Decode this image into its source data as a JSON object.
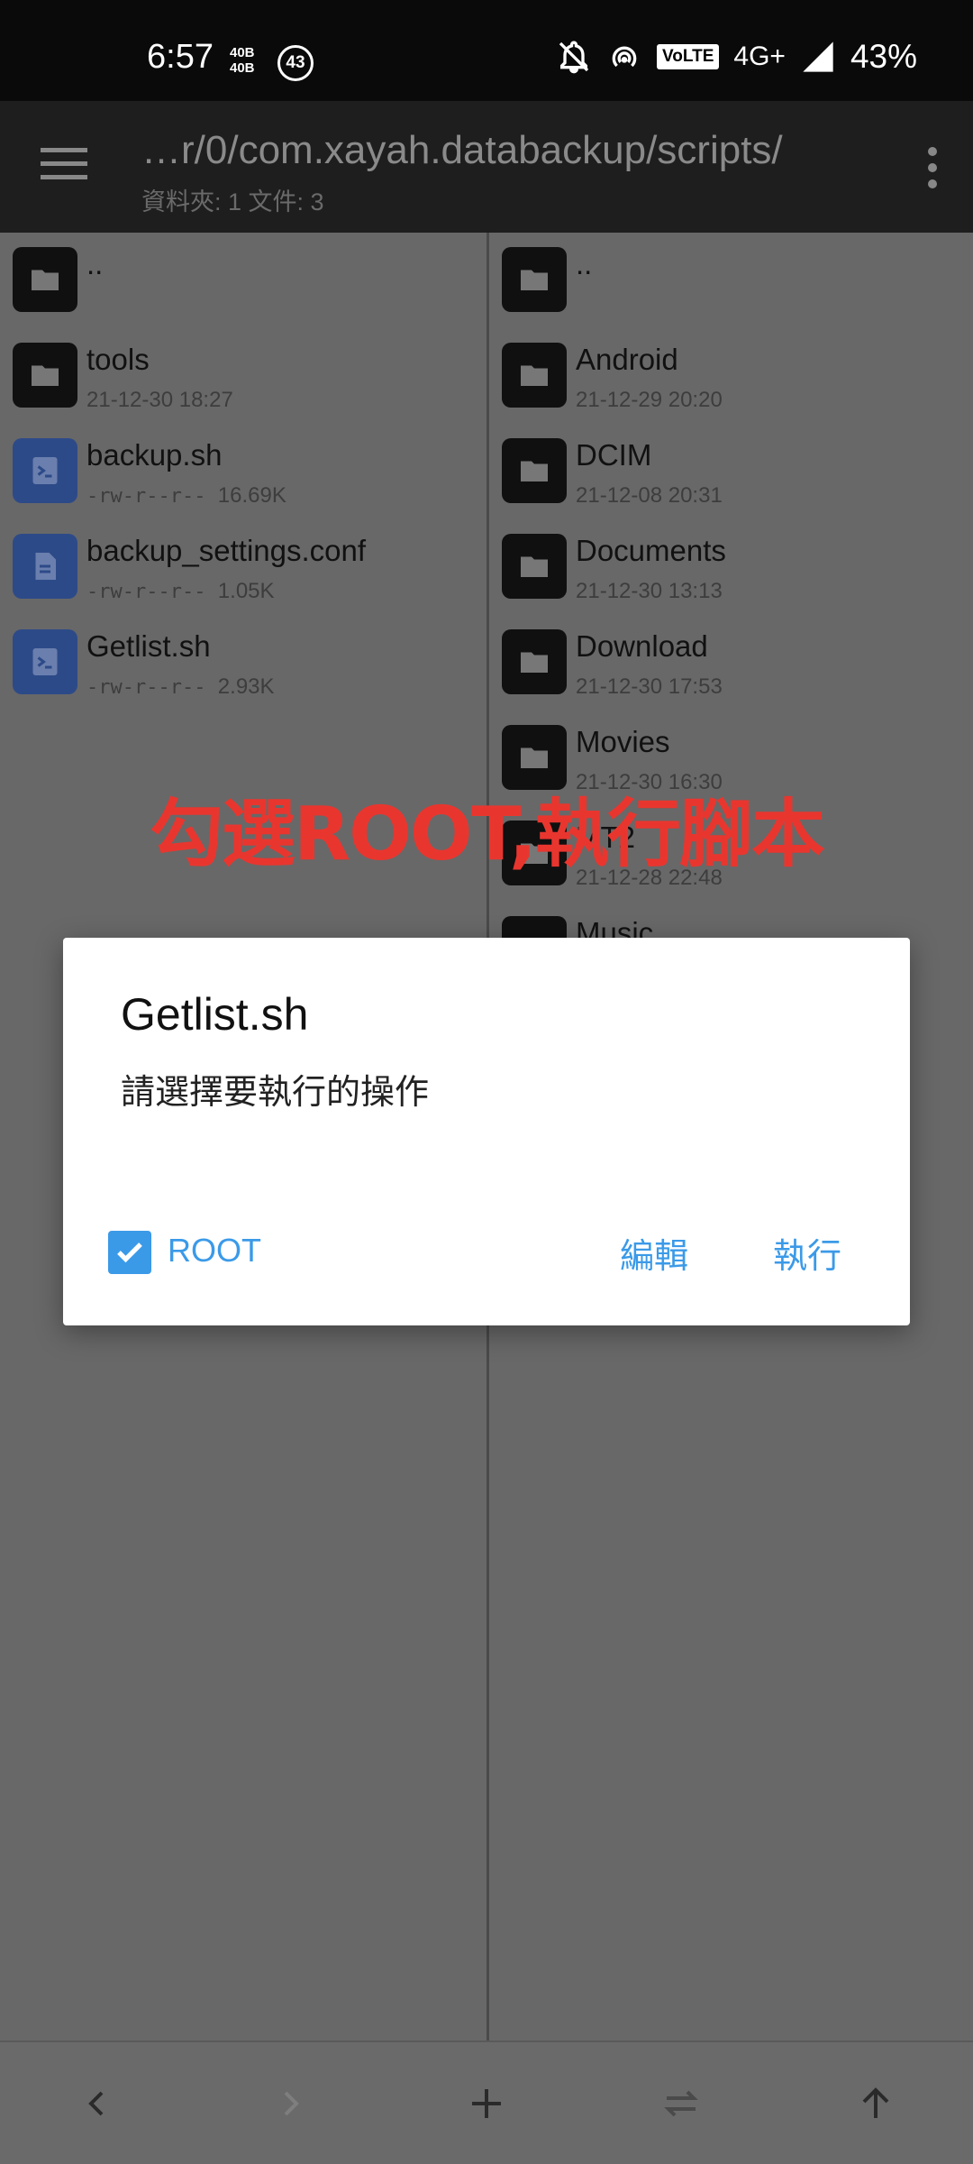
{
  "status_bar": {
    "time": "6:57",
    "data_speed_top": "40B",
    "data_speed_bottom": "40B",
    "notif_count": "43",
    "volte": "VoLTE",
    "network": "4G+",
    "battery": "43%"
  },
  "toolbar": {
    "path": "…r/0/com.xayah.databackup/scripts/",
    "summary": "資料夾: 1  文件: 3"
  },
  "left_pane": {
    "items": [
      {
        "name": "..",
        "meta": "",
        "type": "folder"
      },
      {
        "name": "tools",
        "meta": "21-12-30 18:27",
        "type": "folder"
      },
      {
        "name": "backup.sh",
        "perm": "-rw-r--r--",
        "size": "16.69K",
        "type": "script"
      },
      {
        "name": "backup_settings.conf",
        "perm": "-rw-r--r--",
        "size": "1.05K",
        "type": "doc"
      },
      {
        "name": "Getlist.sh",
        "perm": "-rw-r--r--",
        "size": "2.93K",
        "type": "script"
      }
    ]
  },
  "right_pane": {
    "items": [
      {
        "name": "..",
        "meta": ""
      },
      {
        "name": "Android",
        "meta": "21-12-29 20:20"
      },
      {
        "name": "DCIM",
        "meta": "21-12-08 20:31"
      },
      {
        "name": "Documents",
        "meta": "21-12-30 13:13"
      },
      {
        "name": "Download",
        "meta": "21-12-30 17:53"
      },
      {
        "name": "Movies",
        "meta": "21-12-30 16:30"
      },
      {
        "name": "MT2",
        "meta": "21-12-28 22:48"
      },
      {
        "name": "Music",
        "meta": ""
      }
    ]
  },
  "annotation": "勾選ROOT,執行腳本",
  "dialog": {
    "title": "Getlist.sh",
    "message": "請選擇要執行的操作",
    "checkbox_label": "ROOT",
    "checkbox_checked": true,
    "edit_label": "編輯",
    "run_label": "執行"
  },
  "colors": {
    "accent": "#3b9ae8",
    "annotation": "#e8362f",
    "toolbar": "#1e1e1e"
  },
  "bottom_bar": {
    "icons": [
      "back-arrow-icon",
      "forward-arrow-icon",
      "add-icon",
      "swap-icon",
      "up-arrow-icon"
    ]
  }
}
